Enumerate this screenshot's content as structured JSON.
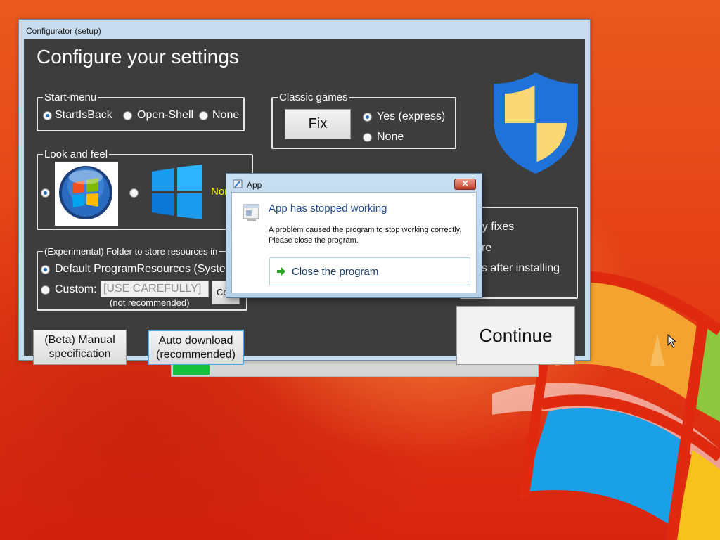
{
  "window": {
    "title": "Configurator (setup)",
    "heading": "Configure your settings"
  },
  "start_menu": {
    "legend": "Start-menu",
    "options": [
      {
        "label": "StartIsBack",
        "selected": true
      },
      {
        "label": "Open-Shell",
        "selected": false
      },
      {
        "label": "None",
        "selected": false
      }
    ]
  },
  "classic_games": {
    "legend": "Classic games",
    "fix_label": "Fix",
    "options": [
      {
        "label": "Yes (express)",
        "selected": true
      },
      {
        "label": "None",
        "selected": false
      }
    ]
  },
  "look_and_feel": {
    "legend": "Look and feel",
    "options": [
      {
        "icon": "windows7-orb-icon",
        "selected": true
      },
      {
        "icon": "windows11-logo-icon",
        "label": "Normal",
        "selected": false
      }
    ]
  },
  "extras_partial": {
    "line1": "try fixes",
    "line2": "are",
    "line3": "es after installing"
  },
  "resources": {
    "legend": "(Experimental) Folder to store resources in",
    "default_label": "Default ProgramResources (Syster",
    "custom_label": "Custom:",
    "custom_value": "[USE CAREFULLY]",
    "custom_note": "(not recommended)",
    "browse_label": "Co"
  },
  "buttons": {
    "manual_spec": "(Beta) Manual specification",
    "auto_download": "Auto download (recommended)",
    "continue": "Continue"
  },
  "progress": {
    "fraction": 0.1
  },
  "error_dialog": {
    "title": "App",
    "close_glyph": "✕",
    "heading": "App has stopped working",
    "message": "A problem caused the program to stop working correctly. Please close the program.",
    "action": "Close the program"
  },
  "icons": {
    "shield": "security-shield-icon",
    "app": "app-icon",
    "program": "program-icon",
    "arrow": "green-arrow-icon",
    "cursor": "mouse-cursor-icon"
  },
  "colors": {
    "window_client": "#3d3d3d",
    "normal_label": "#ffff00",
    "progress_fill": "#13c13a",
    "dialog_heading": "#1e4d9b",
    "shield_blue": "#1f72d8",
    "shield_yellow": "#fbd873"
  }
}
